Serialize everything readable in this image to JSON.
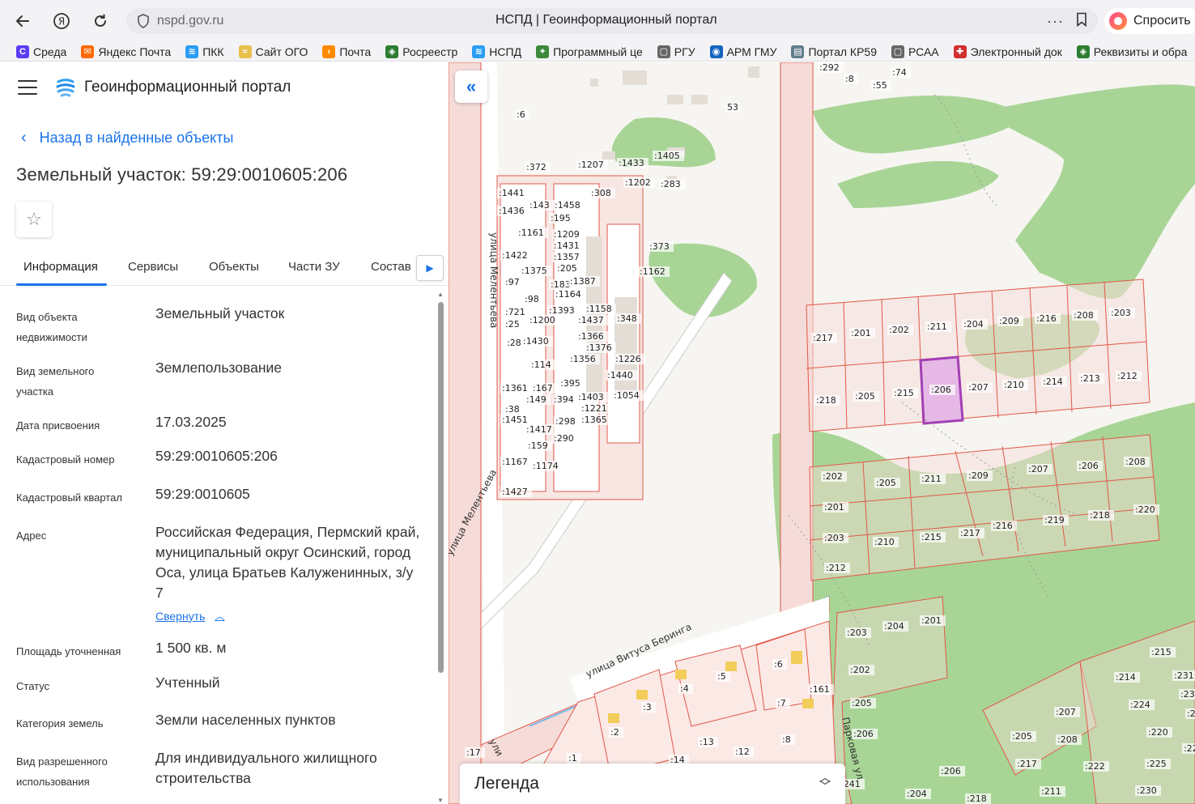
{
  "browser": {
    "url": "nspd.gov.ru",
    "page_title": "НСПД | Геоинформационный портал",
    "ask_label": "Спросить",
    "bookmarks": [
      {
        "label": "Среда",
        "color": "#5b3cf5",
        "icon": "С"
      },
      {
        "label": "Яндекс Почта",
        "color": "#ff6a00",
        "icon": "✉"
      },
      {
        "label": "ПКК",
        "color": "#2a9df4",
        "icon": "≋"
      },
      {
        "label": "Сайт ОГО",
        "color": "#e8c04a",
        "icon": "≈"
      },
      {
        "label": "Почта",
        "color": "#ff8a00",
        "icon": "›"
      },
      {
        "label": "Росреестр",
        "color": "#2e7d32",
        "icon": "◈"
      },
      {
        "label": "НСПД",
        "color": "#2a9df4",
        "icon": "≋"
      },
      {
        "label": "Программный це",
        "color": "#3a8a3a",
        "icon": "✦"
      },
      {
        "label": "РГУ",
        "color": "#666666",
        "icon": "▢"
      },
      {
        "label": "АРМ ГМУ",
        "color": "#1565c0",
        "icon": "◉"
      },
      {
        "label": "Портал КР59",
        "color": "#607d8b",
        "icon": "▤"
      },
      {
        "label": "РСАА",
        "color": "#666666",
        "icon": "▢"
      },
      {
        "label": "Электронный док",
        "color": "#d32f2f",
        "icon": "✚"
      },
      {
        "label": "Реквизиты и обра",
        "color": "#2e7d32",
        "icon": "◈"
      }
    ]
  },
  "sidebar": {
    "portal_title": "Геоинформационный портал",
    "back_label": "Назад в найденные объекты",
    "object_title": "Земельный участок: 59:29:0010605:206",
    "tabs": [
      "Информация",
      "Сервисы",
      "Объекты",
      "Части ЗУ",
      "Состав"
    ],
    "properties": [
      {
        "label": "Вид объекта недвижимости",
        "value": "Земельный участок"
      },
      {
        "label": "Вид земельного участка",
        "value": "Землепользование"
      },
      {
        "label": "Дата присвоения",
        "value": "17.03.2025"
      },
      {
        "label": "Кадастровый номер",
        "value": "59:29:0010605:206"
      },
      {
        "label": "Кадастровый квартал",
        "value": "59:29:0010605"
      },
      {
        "label": "Адрес",
        "value": "Российская Федерация, Пермский край, муниципальный округ Осинский, город Оса, улица Братьев Калуженинных, з/у 7"
      },
      {
        "label": "Площадь уточненная",
        "value": "1 500 кв. м"
      },
      {
        "label": "Статус",
        "value": "Учтенный"
      },
      {
        "label": "Категория земель",
        "value": "Земли населенных пунктов"
      },
      {
        "label": "Вид разрешенного использования",
        "value": "Для индивидуального жилищного строительства"
      }
    ],
    "collapse_label": "Свернуть"
  },
  "map": {
    "legend_label": "Легенда",
    "street_labels": [
      "улица Мелентьева",
      "улица Витуса Беринга",
      "Парковая ул",
      "улица Мелентьева",
      "ули"
    ],
    "colors": {
      "parcel_stroke": "#e0584a",
      "parcel_fill": "#f6dcd8",
      "green": "#9fd08a",
      "selected": "#a33fb5",
      "selected_fill": "#e6b8e6"
    }
  }
}
